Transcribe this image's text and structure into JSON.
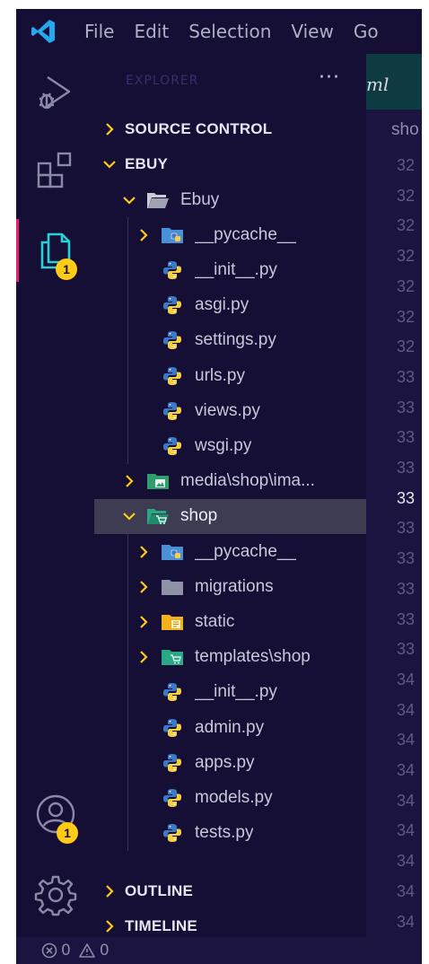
{
  "titlebar": {
    "menu": [
      "File",
      "Edit",
      "Selection",
      "View",
      "Go"
    ]
  },
  "activity": {
    "explorer_badge": "1",
    "accounts_badge": "1"
  },
  "sidebar": {
    "title": "EXPLORER",
    "more": "···",
    "sections": {
      "source_control": "SOURCE CONTROL",
      "workspace": "EBUY",
      "outline": "OUTLINE",
      "timeline": "TIMELINE"
    },
    "tree": [
      {
        "name": "Ebuy",
        "icon": "folder-open-icon"
      },
      {
        "name": "__pycache__",
        "icon": "python-folder-icon"
      },
      {
        "name": "__init__.py",
        "icon": "python-file-icon"
      },
      {
        "name": "asgi.py",
        "icon": "python-file-icon"
      },
      {
        "name": "settings.py",
        "icon": "python-file-icon"
      },
      {
        "name": "urls.py",
        "icon": "python-file-icon"
      },
      {
        "name": "views.py",
        "icon": "python-file-icon"
      },
      {
        "name": "wsgi.py",
        "icon": "python-file-icon"
      },
      {
        "name": "media\\shop\\ima...",
        "icon": "media-folder-icon"
      },
      {
        "name": "shop",
        "icon": "shop-folder-open-icon"
      },
      {
        "name": "__pycache__",
        "icon": "python-folder-icon"
      },
      {
        "name": "migrations",
        "icon": "folder-icon"
      },
      {
        "name": "static",
        "icon": "static-folder-icon"
      },
      {
        "name": "templates\\shop",
        "icon": "templates-folder-icon"
      },
      {
        "name": "__init__.py",
        "icon": "python-file-icon"
      },
      {
        "name": "admin.py",
        "icon": "python-file-icon"
      },
      {
        "name": "apps.py",
        "icon": "python-file-icon"
      },
      {
        "name": "models.py",
        "icon": "python-file-icon"
      },
      {
        "name": "tests.py",
        "icon": "python-file-icon"
      }
    ]
  },
  "editor": {
    "tab_label": "ml",
    "breadcrumb": "sho",
    "line_numbers": [
      "32",
      "32",
      "32",
      "32",
      "32",
      "32",
      "32",
      "33",
      "33",
      "33",
      "33",
      "33",
      "33",
      "33",
      "33",
      "33",
      "33",
      "34",
      "34",
      "34",
      "34",
      "34",
      "34",
      "34",
      "34",
      "34"
    ],
    "current_line_index": 11
  },
  "statusbar": {
    "errors": "0",
    "warnings": "0"
  },
  "colors": {
    "accent": "#e2216e",
    "badge": "#ffcb14",
    "vscode_blue": "#23a8f2",
    "python_blue": "#3b7ac9",
    "python_yellow": "#f5cf3f"
  }
}
